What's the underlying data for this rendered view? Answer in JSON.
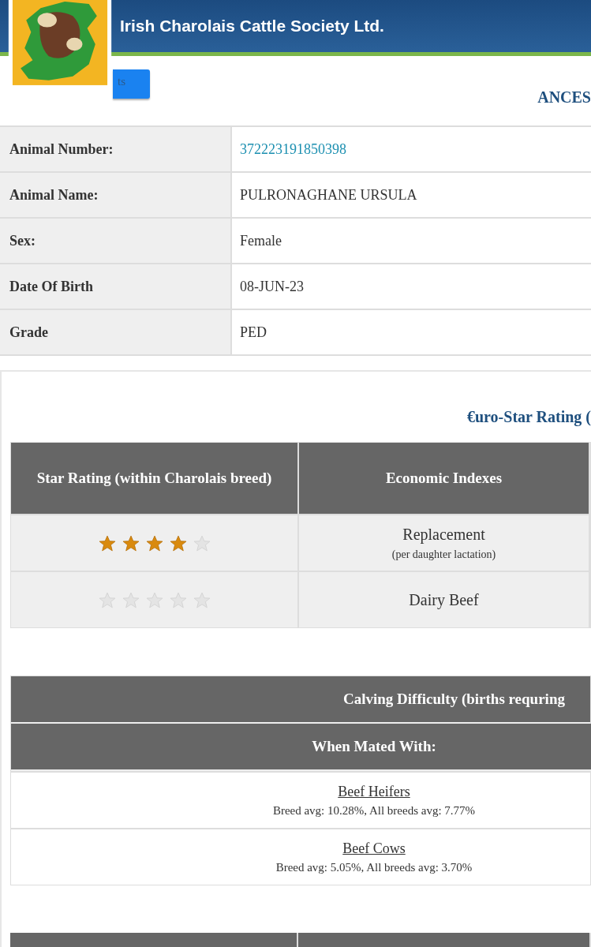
{
  "header": {
    "title": "Irish Charolais Cattle Society Ltd.",
    "back_button": "ts",
    "section_title": "ANCES"
  },
  "animal": [
    {
      "label": "Animal Number:",
      "value": "372223191850398",
      "kind": "link"
    },
    {
      "label": "Animal Name:",
      "value": "PULRONAGHANE URSULA",
      "kind": "text"
    },
    {
      "label": "Sex:",
      "value": "Female",
      "kind": "text"
    },
    {
      "label": "Date Of Birth",
      "value": "08-JUN-23",
      "kind": "text"
    },
    {
      "label": "Grade",
      "value": "PED",
      "kind": "text"
    }
  ],
  "euro_star": {
    "title": "€uro-Star Rating (",
    "columns": [
      "Star Rating (within Charolais breed)",
      "Economic Indexes"
    ],
    "rows": [
      {
        "stars": 4,
        "index": "Replacement",
        "note": "(per daughter lactation)"
      },
      {
        "stars": 0,
        "index": "Dairy Beef"
      }
    ]
  },
  "calving": {
    "title": "Calving Difficulty (births requring",
    "subtitle": "When Mated With:",
    "rows": [
      {
        "label": "Beef Heifers",
        "averages": "Breed avg: 10.28%, All breeds avg: 7.77%"
      },
      {
        "label": "Beef Cows",
        "averages": "Breed avg: 5.05%, All breeds avg: 3.70%"
      }
    ]
  }
}
